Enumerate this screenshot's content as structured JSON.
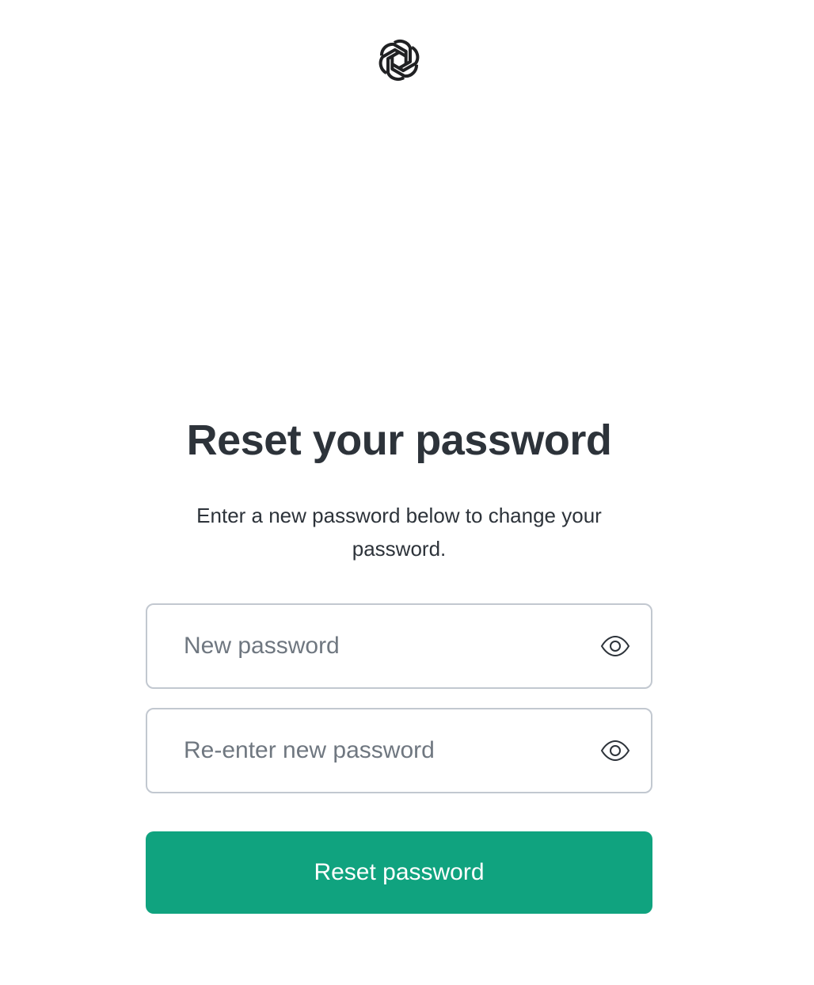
{
  "header": {
    "logo_icon": "openai-logo-icon"
  },
  "form": {
    "title": "Reset your password",
    "subtitle": "Enter a new password below to change your password.",
    "new_password": {
      "placeholder": "New password",
      "value": "",
      "toggle_icon": "eye-icon"
    },
    "confirm_password": {
      "placeholder": "Re-enter new password",
      "value": "",
      "toggle_icon": "eye-icon"
    },
    "submit_label": "Reset password"
  },
  "colors": {
    "accent": "#10a37f",
    "text": "#2d333a",
    "placeholder": "#6f7780",
    "border": "#c2c8d0"
  }
}
